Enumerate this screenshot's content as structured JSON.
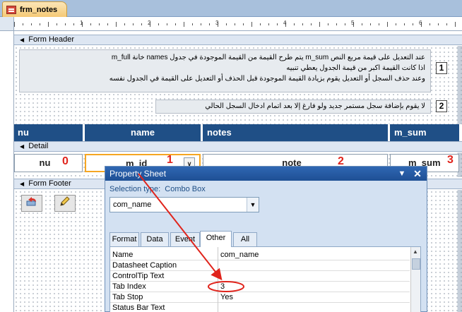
{
  "document_tab": {
    "title": "frm_notes",
    "icon": "form-icon"
  },
  "ruler": {
    "numbers": [
      "1",
      "2",
      "3",
      "4",
      "5",
      "6"
    ]
  },
  "sections": {
    "form_header": "Form Header",
    "detail": "Detail",
    "form_footer": "Form Footer"
  },
  "header_notes": {
    "box1_number": "1",
    "box1_lines": [
      "عند التعديل على قيمة مربع النص m_sum يتم طرح القيمة من القيمة الموجودة في جدول names خانة m_full",
      "اذا كانت القيمة اكبر من قيمة الجدول يعطي تنبيه",
      "وعند حذف السجل أو التعديل يقوم بزيادة القيمة الموجودة قبل الحذف أو التعديل على القيمة في الجدول نفسه"
    ],
    "box2_number": "2",
    "box2_line": "لا يقوم بإضافة سجل مستمر جديد ولو فارغ إلا بعد اتمام ادخال السجل الحالي"
  },
  "column_headers": [
    "nu",
    "name",
    "notes",
    "m_sum"
  ],
  "detail_controls": [
    {
      "text": "nu",
      "tab_order": "0"
    },
    {
      "text": "m_id",
      "tab_order": "1"
    },
    {
      "text": "note",
      "tab_order": "2"
    },
    {
      "text": "m_sum",
      "tab_order": "3"
    }
  ],
  "footer_buttons": [
    {
      "icon": "undo-record-icon"
    },
    {
      "icon": "pencil-edit-icon"
    }
  ],
  "property_sheet": {
    "title": "Property Sheet",
    "selection_type_label": "Selection type:",
    "selection_type_value": "Combo Box",
    "selected_object": "com_name",
    "tabs": [
      "Format",
      "Data",
      "Event",
      "Other",
      "All"
    ],
    "active_tab": "Other",
    "rows": [
      {
        "name": "Name",
        "value": "com_name"
      },
      {
        "name": "Datasheet Caption",
        "value": ""
      },
      {
        "name": "ControlTip Text",
        "value": ""
      },
      {
        "name": "Tab Index",
        "value": "3"
      },
      {
        "name": "Tab Stop",
        "value": "Yes"
      },
      {
        "name": "Status Bar Text",
        "value": ""
      }
    ]
  },
  "colors": {
    "header_strip": "#1f4f86",
    "annotation_red": "#e0241c",
    "selection_orange": "#f5a623"
  }
}
